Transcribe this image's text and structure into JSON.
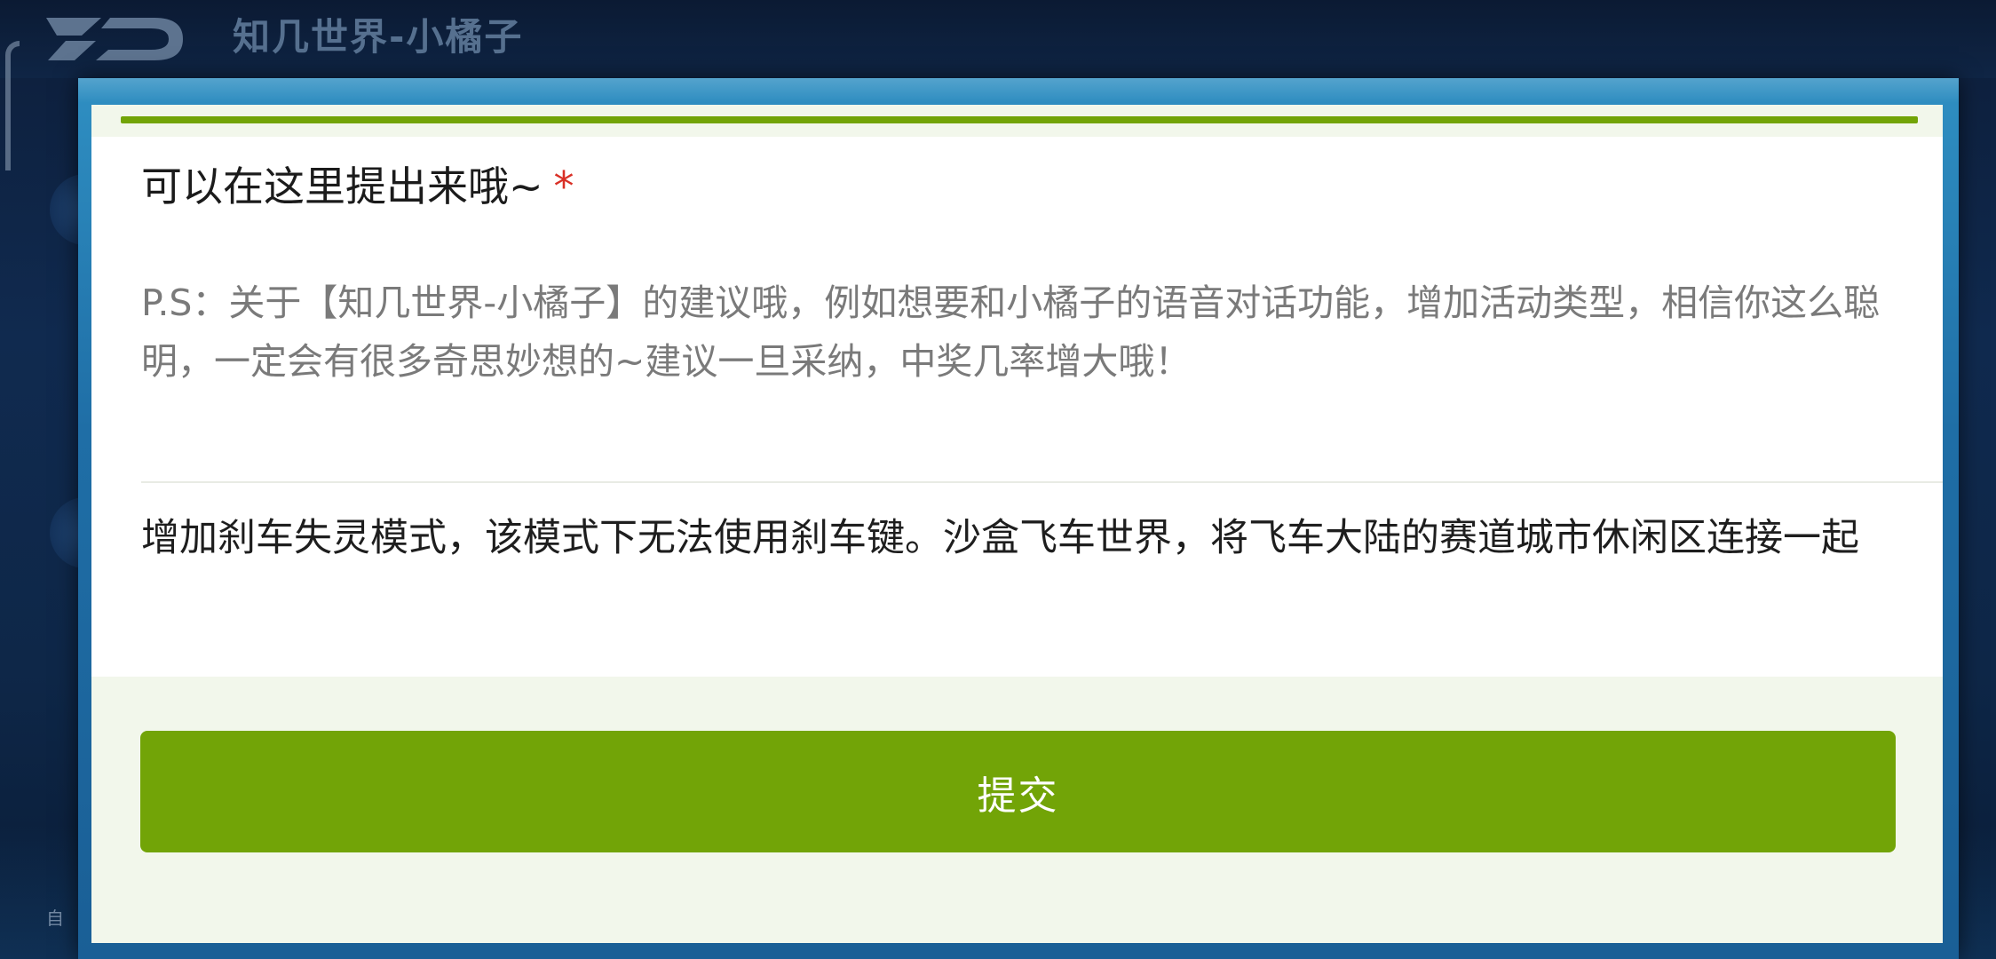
{
  "background": {
    "app_title": "知几世界-小橘子",
    "side_label": "自"
  },
  "dialog": {
    "question": {
      "title": "可以在这里提出来哦~",
      "required_mark": "*",
      "description": "P.S：关于【知几世界-小橘子】的建议哦，例如想要和小橘子的语音对话功能，增加活动类型，相信你这么聪明，一定会有很多奇思妙想的~建议一旦采纳，中奖几率增大哦！",
      "answer_value": "增加刹车失灵模式，该模式下无法使用刹车键。沙盒飞车世界，将飞车大陆的赛道城市休闲区连接一起"
    },
    "submit_label": "提交"
  },
  "colors": {
    "accent": "#72a407",
    "required": "#d93026",
    "content_bg": "#f2f7eb",
    "frame": "#2f8fc2"
  }
}
